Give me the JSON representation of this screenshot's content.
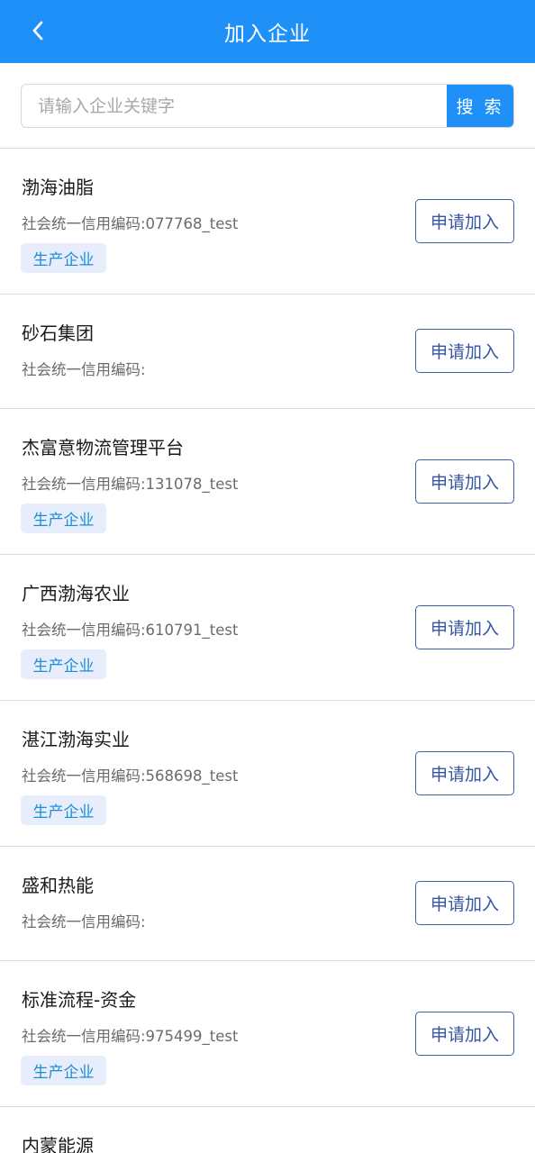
{
  "header": {
    "title": "加入企业",
    "back_icon": "chevron-left-icon"
  },
  "search": {
    "placeholder": "请输入企业关键字",
    "value": "",
    "button_label": "搜 索"
  },
  "colors": {
    "primary": "#1e90f7",
    "button_border": "#3d5fa8",
    "tag_background": "#e8edfb",
    "tag_text": "#1a8fd8"
  },
  "companies": [
    {
      "name": "渤海油脂",
      "code": "社会统一信用编码:077768_test",
      "tag": "生产企业",
      "button": "申请加入"
    },
    {
      "name": "砂石集团",
      "code": "社会统一信用编码:",
      "button": "申请加入"
    },
    {
      "name": "杰富意物流管理平台",
      "code": "社会统一信用编码:131078_test",
      "tag": "生产企业",
      "button": "申请加入"
    },
    {
      "name": "广西渤海农业",
      "code": "社会统一信用编码:610791_test",
      "tag": "生产企业",
      "button": "申请加入"
    },
    {
      "name": "湛江渤海实业",
      "code": "社会统一信用编码:568698_test",
      "tag": "生产企业",
      "button": "申请加入"
    },
    {
      "name": "盛和热能",
      "code": "社会统一信用编码:",
      "button": "申请加入"
    },
    {
      "name": "标准流程-资金",
      "code": "社会统一信用编码:975499_test",
      "tag": "生产企业",
      "button": "申请加入"
    },
    {
      "name": "内蒙能源"
    }
  ]
}
